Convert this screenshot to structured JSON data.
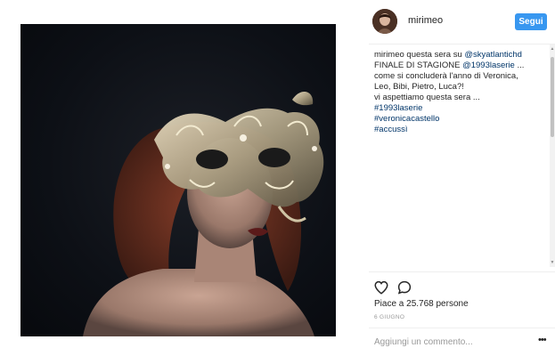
{
  "post": {
    "image_alt": "woman wearing ornate masquerade mask"
  },
  "header": {
    "username": "mirimeo",
    "follow_label": "Segui"
  },
  "caption": {
    "username": "mirimeo",
    "line1_text": " questa sera su ",
    "line1_link": "@skyatlantichd",
    "line2_text": "FINALE DI STAGIONE ",
    "line2_link": "@1993laserie",
    "line2_suffix": " ...",
    "line3": "come si concluderà l'anno di Veronica,",
    "line4": "Leo, Bibi, Pietro, Luca?!",
    "line5": "vi aspettiamo questa sera ...",
    "hashtags": [
      "#1993laserie",
      "#veronicacastello",
      "#accussì"
    ]
  },
  "actions": {
    "like_icon": "heart-outline-icon",
    "comment_icon": "comment-bubble-icon"
  },
  "likes_text": "Piace a 25.768 persone",
  "date_text": "6 GIUGNO",
  "comment": {
    "placeholder": "Aggiungi un commento...",
    "more_icon": "more-options-icon"
  },
  "colors": {
    "follow_button": "#3897f0",
    "link": "#003569",
    "muted": "#999999"
  }
}
